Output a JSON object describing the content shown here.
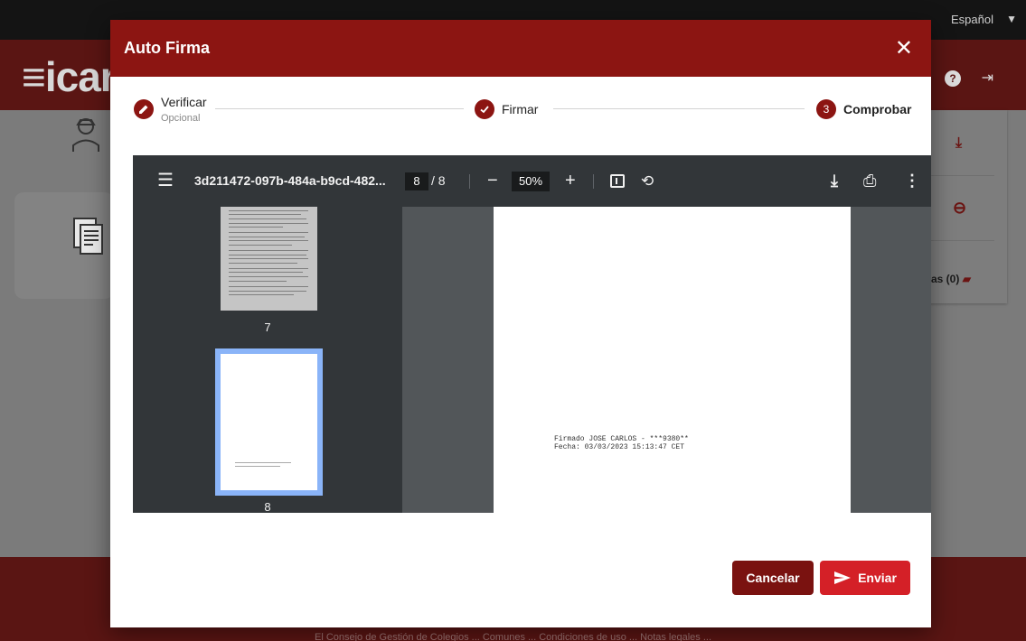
{
  "background": {
    "language": "Español",
    "logo": "≡icar",
    "badge_label": "as (0)",
    "footer_text": "El Consejo de Gestión de Colegios ...  Comunes ...  Condiciones de uso ...  Notas legales ..."
  },
  "modal": {
    "title": "Auto Firma",
    "close_icon": "close-icon"
  },
  "stepper": {
    "steps": [
      {
        "label": "Verificar",
        "sublabel": "Opcional",
        "icon": "pencil-icon",
        "state": "done"
      },
      {
        "label": "Firmar",
        "icon": "check-icon",
        "state": "done"
      },
      {
        "label": "Comprobar",
        "number": "3",
        "state": "active"
      }
    ]
  },
  "pdf": {
    "filename": "3d211472-097b-484a-b9cd-482...",
    "current_page": "8",
    "page_of": "/ 8",
    "zoom": "50%",
    "thumbnails": [
      {
        "page": "7"
      },
      {
        "page": "8"
      }
    ],
    "signature_line1": "Firmado JOSE CARLOS - ***9380**",
    "signature_line2": "Fecha: 03/03/2023 15:13:47 CET"
  },
  "actions": {
    "cancel_label": "Cancelar",
    "send_label": "Enviar"
  },
  "colors": {
    "header": "#8c1512",
    "primary": "#d42027",
    "cancel": "#7a1210",
    "pdf_toolbar": "#323639",
    "pdf_bg": "#525659"
  }
}
